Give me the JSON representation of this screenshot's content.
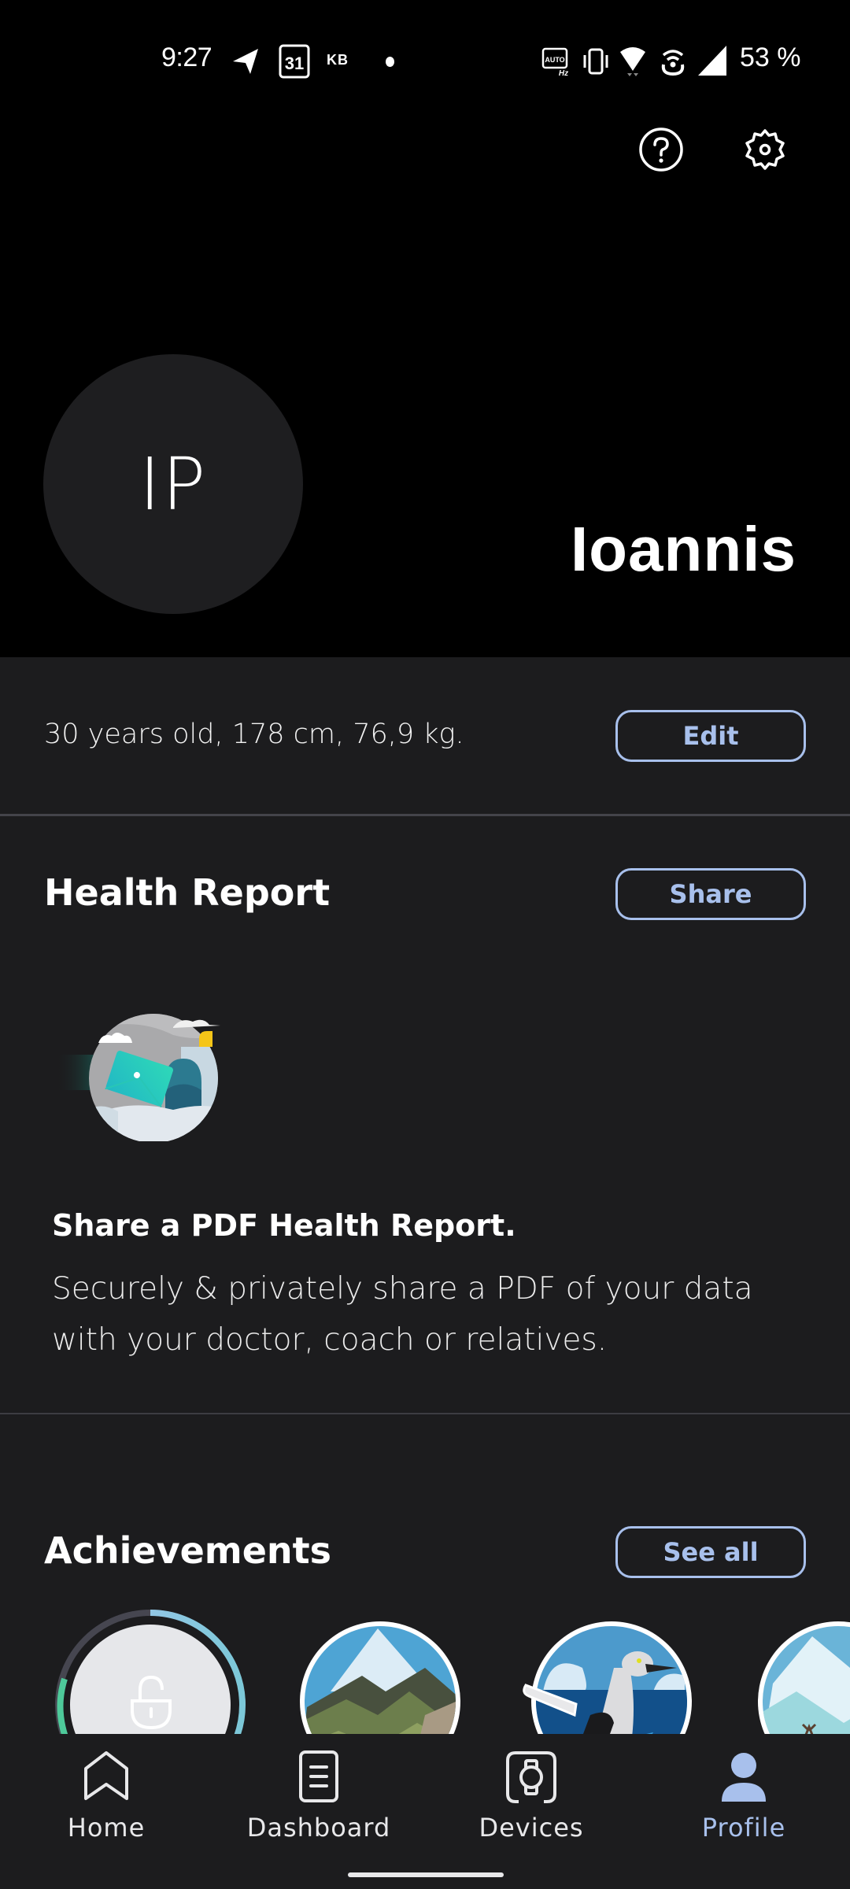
{
  "status_bar": {
    "time": "9:27",
    "kb_label": "KB",
    "calendar_day": "31",
    "battery": "53 %",
    "icons_left": [
      "telegram-icon",
      "calendar-icon",
      "kb-indicator",
      "notification-dot"
    ],
    "icons_right": [
      "auto-hz-icon",
      "vibrate-icon",
      "wifi-icon",
      "hotspot-icon",
      "signal-icon"
    ]
  },
  "header": {
    "help_icon": "help-circle-icon",
    "settings_icon": "gear-icon",
    "avatar_initials": "IP",
    "user_name": "Ioannis"
  },
  "profile_stats": {
    "text": "30 years old, 178 cm, 76,9 kg.",
    "edit_label": "Edit"
  },
  "health_report": {
    "title": "Health Report",
    "share_label": "Share",
    "heading": "Share a PDF Health Report.",
    "body": "Securely & privately share a PDF of your data with your doctor, coach or relatives."
  },
  "achievements": {
    "title": "Achievements",
    "see_all_label": "See all",
    "badges": [
      {
        "name": "locked-achievement",
        "state": "locked",
        "progress": 0.8
      },
      {
        "name": "mountain-achievement",
        "state": "unlocked"
      },
      {
        "name": "booby-bird-achievement",
        "state": "unlocked"
      },
      {
        "name": "glacier-elk-achievement",
        "state": "unlocked"
      }
    ]
  },
  "bottom_nav": {
    "items": [
      {
        "label": "Home",
        "icon": "home-icon",
        "active": false
      },
      {
        "label": "Dashboard",
        "icon": "dashboard-icon",
        "active": false
      },
      {
        "label": "Devices",
        "icon": "watch-icon",
        "active": false
      },
      {
        "label": "Profile",
        "icon": "person-icon",
        "active": true
      }
    ]
  },
  "colors": {
    "accent": "#a8c0ec",
    "background": "#1c1c1e",
    "header_background": "#000000",
    "avatar_background": "#1e1e20",
    "divider": "#44444a"
  }
}
